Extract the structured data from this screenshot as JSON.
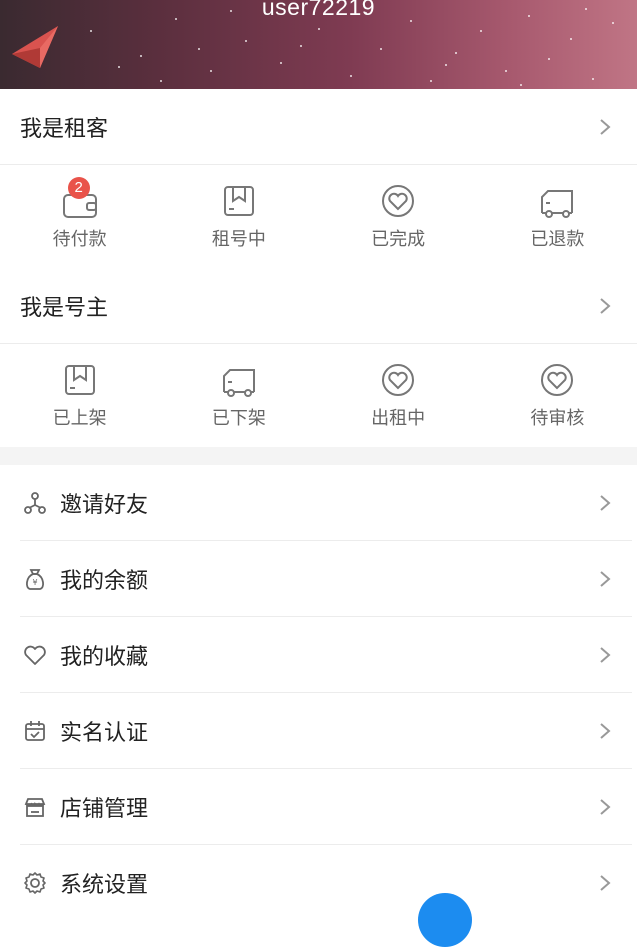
{
  "header": {
    "username": "user72219"
  },
  "renter_section": {
    "title": "我是租客",
    "items": [
      {
        "label": "待付款",
        "icon": "wallet-icon",
        "badge": "2"
      },
      {
        "label": "租号中",
        "icon": "bookmark-box-icon"
      },
      {
        "label": "已完成",
        "icon": "heart-bubble-icon"
      },
      {
        "label": "已退款",
        "icon": "truck-icon"
      }
    ]
  },
  "owner_section": {
    "title": "我是号主",
    "items": [
      {
        "label": "已上架",
        "icon": "bookmark-box-icon"
      },
      {
        "label": "已下架",
        "icon": "truck-icon"
      },
      {
        "label": "出租中",
        "icon": "heart-bubble-icon"
      },
      {
        "label": "待审核",
        "icon": "heart-bubble-icon"
      }
    ]
  },
  "menu": [
    {
      "label": "邀请好友",
      "icon": "share-network-icon"
    },
    {
      "label": "我的余额",
      "icon": "money-bag-icon"
    },
    {
      "label": "我的收藏",
      "icon": "heart-icon"
    },
    {
      "label": "实名认证",
      "icon": "calendar-check-icon"
    },
    {
      "label": "店铺管理",
      "icon": "store-icon"
    },
    {
      "label": "系统设置",
      "icon": "gear-icon"
    }
  ],
  "colors": {
    "badge": "#e9534a",
    "accent_blue": "#1c8cf0",
    "header_start": "#3a2a30",
    "header_end": "#c07585"
  }
}
